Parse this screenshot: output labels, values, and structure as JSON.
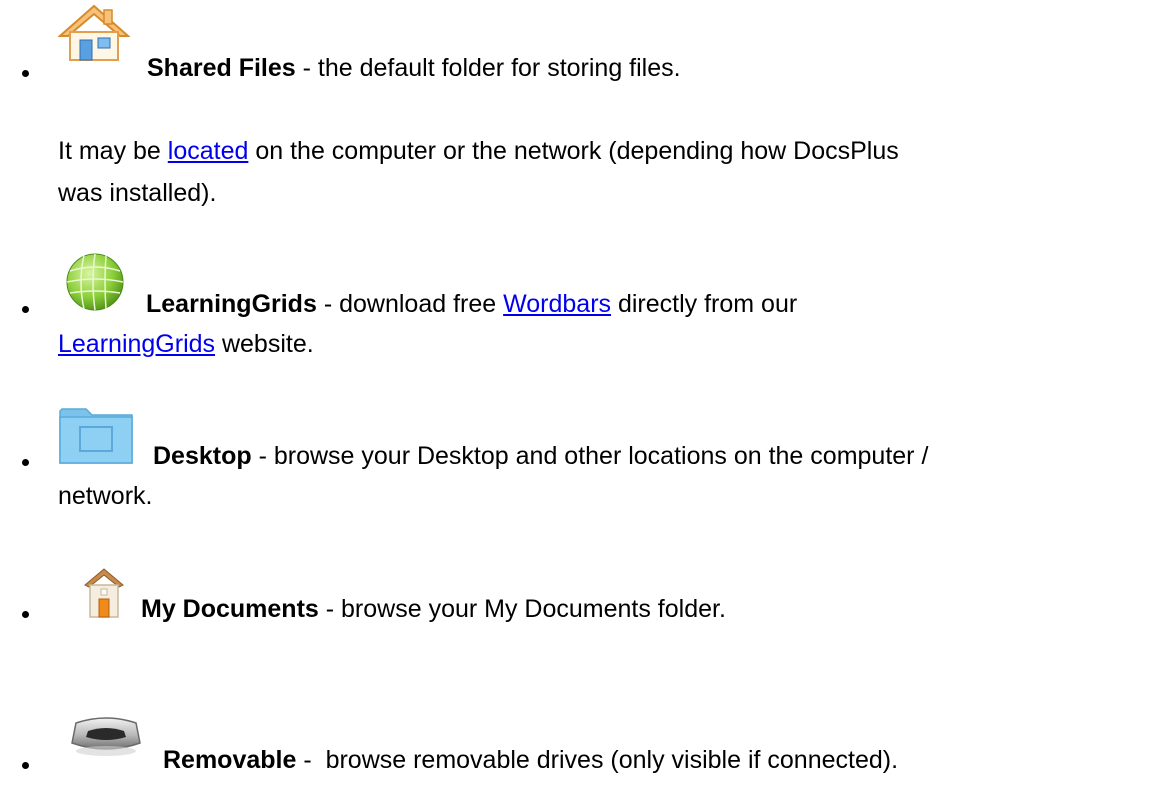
{
  "items": [
    {
      "icon": "house-icon",
      "title": "Shared Files",
      "sep": " - ",
      "desc": "the default folder for storing files.",
      "note_pre": "It may be ",
      "note_link": "located",
      "note_post": " on the computer or the network (depending how DocsPlus",
      "note_line2": "was installed)."
    },
    {
      "icon": "globe-icon",
      "title": "LearningGrids",
      "sep": " - ",
      "desc_pre": "download free ",
      "desc_link": "Wordbars",
      "desc_post": " directly from our",
      "line2_link": "LearningGrids",
      "line2_post": " website."
    },
    {
      "icon": "folder-icon",
      "title": "Desktop",
      "sep": " - ",
      "desc": "browse your Desktop and other locations on the computer /",
      "line2": "network."
    },
    {
      "icon": "home-icon",
      "title": "My Documents",
      "sep": " - ",
      "desc": "browse your My Documents folder."
    },
    {
      "icon": "removable-drive-icon",
      "title": "Removable",
      "sep": " -  ",
      "desc": "browse removable drives (only visible if connected)."
    }
  ]
}
